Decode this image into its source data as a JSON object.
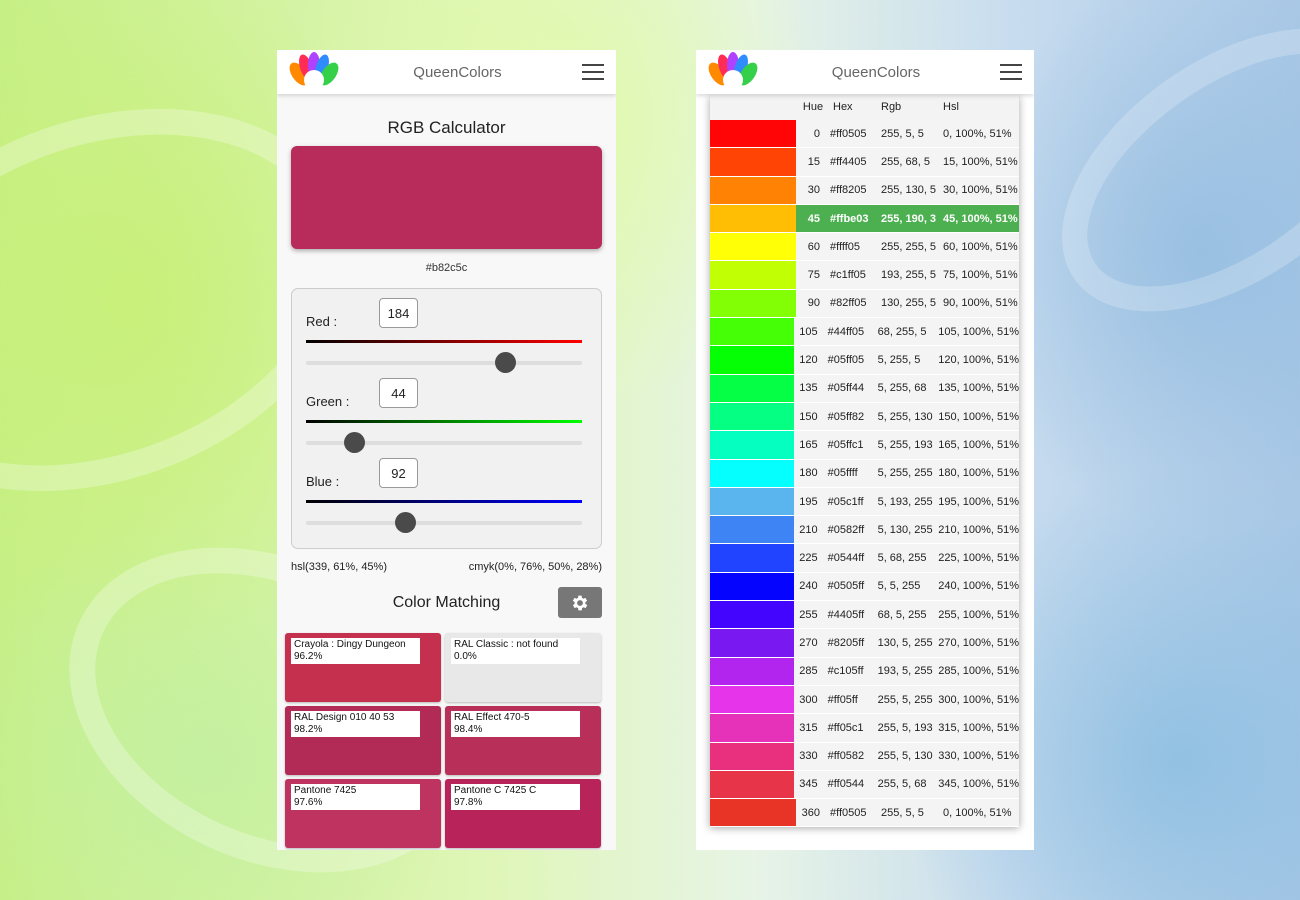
{
  "left_screen": {
    "app_title": "QueenColors",
    "calculator_title": "RGB Calculator",
    "preview_color": "#b82c5c",
    "hex_label": "#b82c5c",
    "channels": [
      {
        "label": "Red :",
        "value": "184",
        "fraction": 0.7216,
        "gradient_end": "#ff0000"
      },
      {
        "label": "Green :",
        "value": "44",
        "fraction": 0.1725,
        "gradient_end": "#00ff00"
      },
      {
        "label": "Blue :",
        "value": "92",
        "fraction": 0.3608,
        "gradient_end": "#0000ff"
      }
    ],
    "hsl_value": "hsl(339, 61%, 45%)",
    "cmyk_value": "cmyk(0%, 76%, 50%, 28%)",
    "matching_title": "Color Matching",
    "settings_icon": "gear-icon",
    "matches": [
      {
        "name": "Crayola : Dingy Dungeon",
        "percent": "96.2%",
        "color": "#c5304f"
      },
      {
        "name": "RAL Classic : not found",
        "percent": "0.0%",
        "color": "#e8e8e8"
      },
      {
        "name": "RAL Design 010 40 53",
        "percent": "98.2%",
        "color": "#b22b57"
      },
      {
        "name": "RAL Effect 470-5",
        "percent": "98.4%",
        "color": "#b8305a"
      },
      {
        "name": "Pantone 7425",
        "percent": "97.6%",
        "color": "#bf3360"
      },
      {
        "name": "Pantone C 7425 C",
        "percent": "97.8%",
        "color": "#b8245a"
      }
    ]
  },
  "right_screen": {
    "app_title": "QueenColors",
    "columns": {
      "hue": "Hue",
      "hex": "Hex",
      "rgb": "Rgb",
      "hsl": "Hsl"
    },
    "selected_hue": "45",
    "rows": [
      {
        "hue": "0",
        "hex": "#ff0505",
        "rgb": "255, 5, 5",
        "hsl": "0, 100%, 51%",
        "color": "#ff0505"
      },
      {
        "hue": "15",
        "hex": "#ff4405",
        "rgb": "255, 68, 5",
        "hsl": "15, 100%, 51%",
        "color": "#ff4405"
      },
      {
        "hue": "30",
        "hex": "#ff8205",
        "rgb": "255, 130, 5",
        "hsl": "30, 100%, 51%",
        "color": "#ff8205"
      },
      {
        "hue": "45",
        "hex": "#ffbe03",
        "rgb": "255, 190, 3",
        "hsl": "45, 100%, 51%",
        "color": "#ffbe03"
      },
      {
        "hue": "60",
        "hex": "#ffff05",
        "rgb": "255, 255, 5",
        "hsl": "60, 100%, 51%",
        "color": "#ffff05"
      },
      {
        "hue": "75",
        "hex": "#c1ff05",
        "rgb": "193, 255, 5",
        "hsl": "75, 100%, 51%",
        "color": "#c1ff05"
      },
      {
        "hue": "90",
        "hex": "#82ff05",
        "rgb": "130, 255, 5",
        "hsl": "90, 100%, 51%",
        "color": "#82ff05"
      },
      {
        "hue": "105",
        "hex": "#44ff05",
        "rgb": "68, 255, 5",
        "hsl": "105, 100%, 51%",
        "color": "#44ff05"
      },
      {
        "hue": "120",
        "hex": "#05ff05",
        "rgb": "5, 255, 5",
        "hsl": "120, 100%, 51%",
        "color": "#05ff05"
      },
      {
        "hue": "135",
        "hex": "#05ff44",
        "rgb": "5, 255, 68",
        "hsl": "135, 100%, 51%",
        "color": "#05ff44"
      },
      {
        "hue": "150",
        "hex": "#05ff82",
        "rgb": "5, 255, 130",
        "hsl": "150, 100%, 51%",
        "color": "#05ff82"
      },
      {
        "hue": "165",
        "hex": "#05ffc1",
        "rgb": "5, 255, 193",
        "hsl": "165, 100%, 51%",
        "color": "#05ffc1"
      },
      {
        "hue": "180",
        "hex": "#05ffff",
        "rgb": "5, 255, 255",
        "hsl": "180, 100%, 51%",
        "color": "#05ffff"
      },
      {
        "hue": "195",
        "hex": "#05c1ff",
        "rgb": "5, 193, 255",
        "hsl": "195, 100%, 51%",
        "color": "#5ab4ee"
      },
      {
        "hue": "210",
        "hex": "#0582ff",
        "rgb": "5, 130, 255",
        "hsl": "210, 100%, 51%",
        "color": "#3f84f5"
      },
      {
        "hue": "225",
        "hex": "#0544ff",
        "rgb": "5, 68, 255",
        "hsl": "225, 100%, 51%",
        "color": "#2044ff"
      },
      {
        "hue": "240",
        "hex": "#0505ff",
        "rgb": "5, 5, 255",
        "hsl": "240, 100%, 51%",
        "color": "#0505ff"
      },
      {
        "hue": "255",
        "hex": "#4405ff",
        "rgb": "68, 5, 255",
        "hsl": "255, 100%, 51%",
        "color": "#4405ff"
      },
      {
        "hue": "270",
        "hex": "#8205ff",
        "rgb": "130, 5, 255",
        "hsl": "270, 100%, 51%",
        "color": "#7a18f2"
      },
      {
        "hue": "285",
        "hex": "#c105ff",
        "rgb": "193, 5, 255",
        "hsl": "285, 100%, 51%",
        "color": "#b125ef"
      },
      {
        "hue": "300",
        "hex": "#ff05ff",
        "rgb": "255, 5, 255",
        "hsl": "300, 100%, 51%",
        "color": "#e534ea"
      },
      {
        "hue": "315",
        "hex": "#ff05c1",
        "rgb": "255, 5, 193",
        "hsl": "315, 100%, 51%",
        "color": "#e532b8"
      },
      {
        "hue": "330",
        "hex": "#ff0582",
        "rgb": "255, 5, 130",
        "hsl": "330, 100%, 51%",
        "color": "#e8307f"
      },
      {
        "hue": "345",
        "hex": "#ff0544",
        "rgb": "255, 5, 68",
        "hsl": "345, 100%, 51%",
        "color": "#e83448"
      },
      {
        "hue": "360",
        "hex": "#ff0505",
        "rgb": "255, 5, 5",
        "hsl": "0, 100%, 51%",
        "color": "#e83426"
      }
    ]
  }
}
